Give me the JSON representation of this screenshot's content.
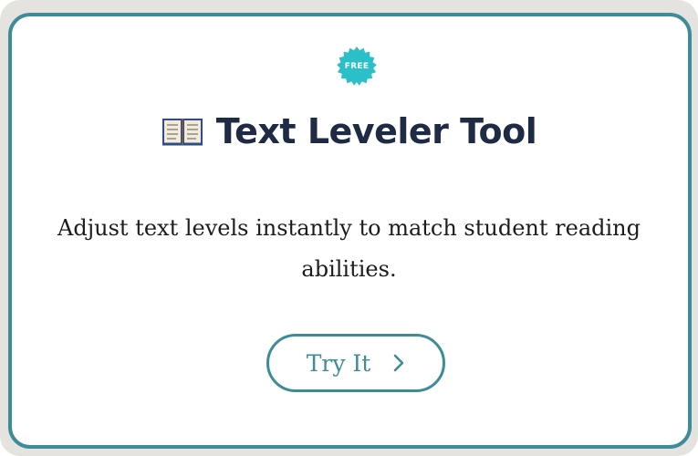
{
  "badge": {
    "label": "FREE",
    "icon": "starburst-badge-icon",
    "color": "#2bbfc9"
  },
  "header": {
    "icon": "open-book-icon",
    "title": "Text Leveler Tool"
  },
  "main": {
    "description": "Adjust text levels instantly to match student reading abilities."
  },
  "cta": {
    "label": "Try It",
    "icon": "chevron-right-icon"
  },
  "colors": {
    "accent": "#3d8c97",
    "title": "#1f2a44",
    "text": "#1c1c1c",
    "backdrop": "#e4e3df"
  }
}
